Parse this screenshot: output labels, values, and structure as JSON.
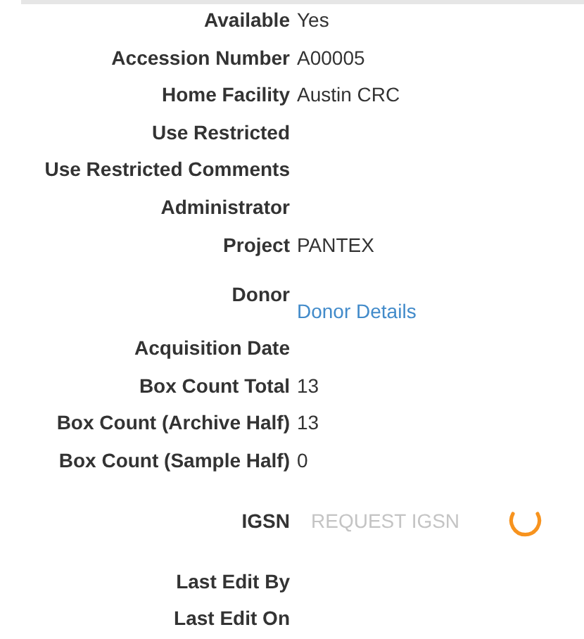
{
  "fields": [
    {
      "kind": "text",
      "label": "Available",
      "value": "Yes"
    },
    {
      "kind": "text",
      "label": "Accession Number",
      "value": "A00005"
    },
    {
      "kind": "text",
      "label": "Home Facility",
      "value": "Austin CRC"
    },
    {
      "kind": "text",
      "label": "Use Restricted"
    },
    {
      "kind": "text",
      "label": "Use Restricted Comments"
    },
    {
      "kind": "text",
      "label": "Administrator"
    },
    {
      "kind": "text",
      "label": "Project",
      "value": "PANTEX"
    },
    {
      "kind": "link",
      "label": "Donor",
      "value": "Donor Details"
    },
    {
      "kind": "text",
      "label": "Acquisition Date"
    },
    {
      "kind": "text",
      "label": "Box Count Total",
      "value": "13"
    },
    {
      "kind": "text",
      "label": "Box Count (Archive Half)",
      "value": "13"
    },
    {
      "kind": "text",
      "label": "Box Count (Sample Half)",
      "value": "0"
    },
    {
      "kind": "button",
      "label": "IGSN",
      "value": "REQUEST IGSN",
      "disabled": true,
      "loading": true
    },
    {
      "kind": "text",
      "label": "Last Edit By"
    },
    {
      "kind": "text",
      "label": "Last Edit On"
    }
  ]
}
